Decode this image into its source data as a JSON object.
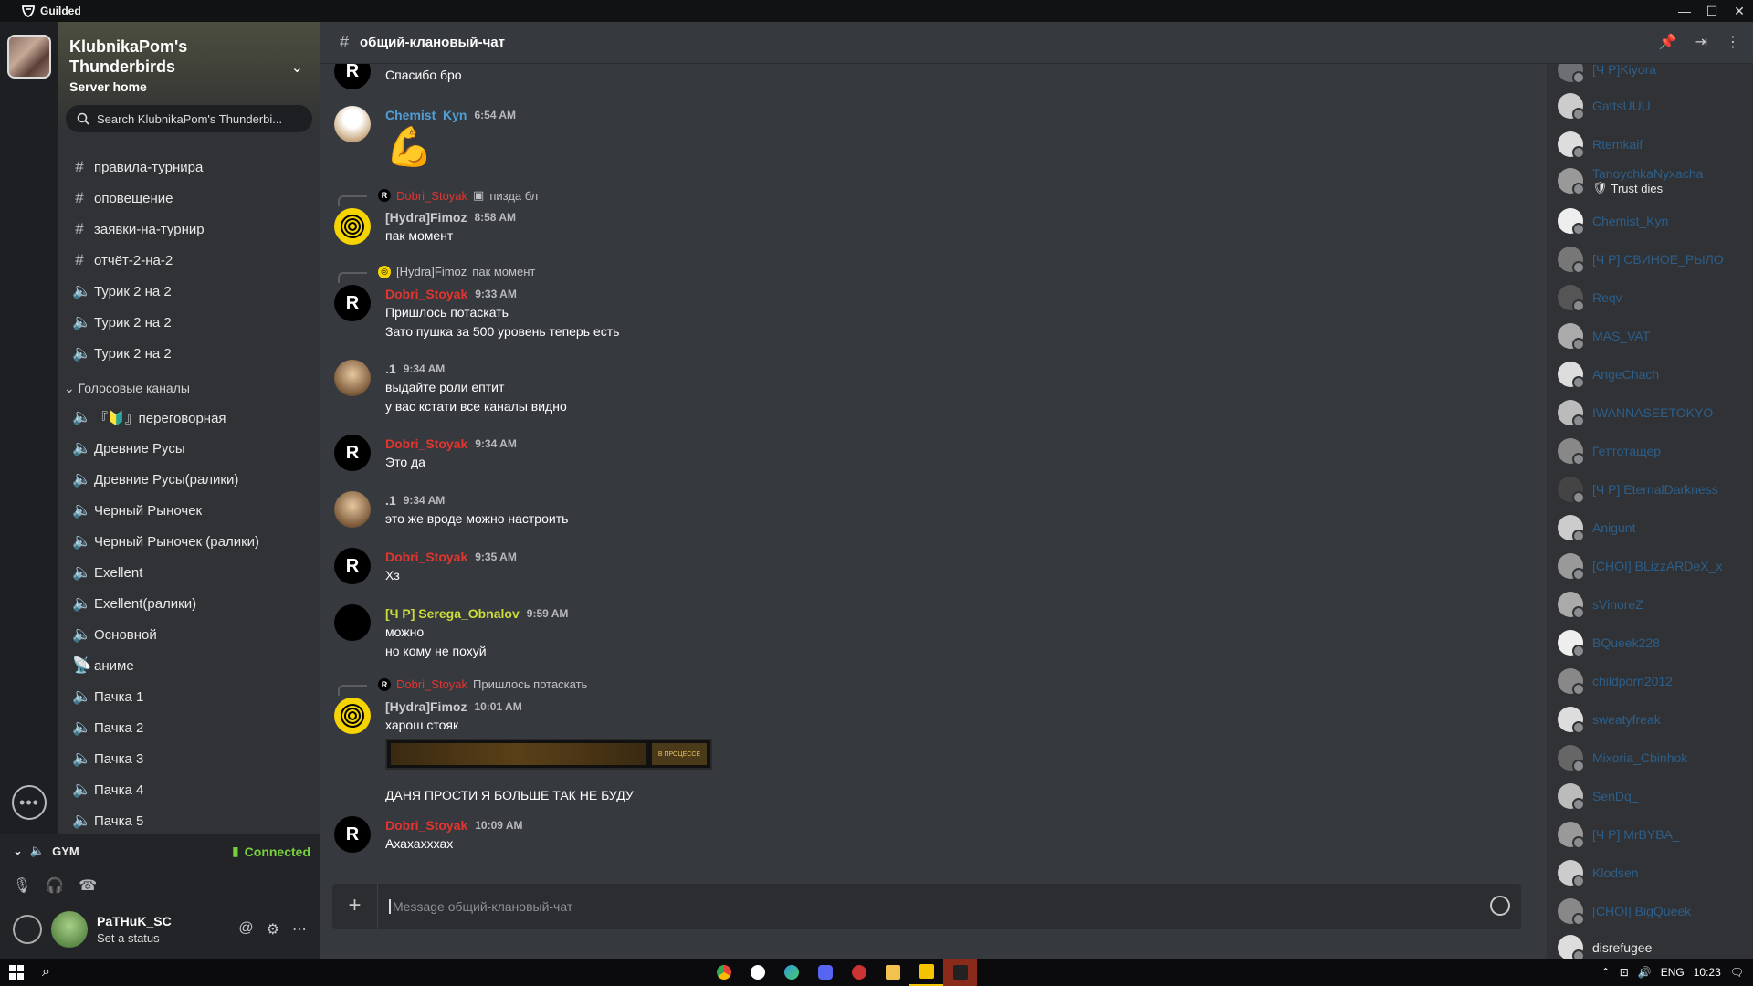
{
  "app": {
    "title": "Guilded"
  },
  "server": {
    "name": "KlubnikaPom's Thunderbirds",
    "home": "Server home",
    "search_placeholder": "Search KlubnikaPom's Thunderbi..."
  },
  "channels": {
    "text": [
      "правила-турнира",
      "оповещение",
      "заявки-на-турнир",
      "отчёт-2-на-2"
    ],
    "voice_top": [
      "Турик 2 на 2",
      "Турик 2 на 2",
      "Турик 2 на 2"
    ],
    "category": "Голосовые каналы",
    "voice": [
      "『🔰』переговорная",
      "Древние Русы",
      "Древние Русы(ралики)",
      "Черный Рыночек",
      "Черный Рыночек (ралики)",
      "Exellent",
      "Exellent(ралики)",
      "Основной",
      "аниме",
      "Пачка 1",
      "Пачка 2",
      "Пачка 3",
      "Пачка 4",
      "Пачка 5"
    ]
  },
  "voice_status": {
    "channel": "GYM",
    "status": "Connected"
  },
  "user": {
    "name": "PaTHuK_SC",
    "status": "Set a status"
  },
  "current_channel": "общий-клановый-чат",
  "messages": [
    {
      "lines": [
        "Спасибо бро"
      ]
    },
    {
      "author": "Chemist_Kyn",
      "time": "6:54 AM",
      "emoji": "💪"
    },
    {
      "reply_author": "Dobri_Stoyak",
      "reply_text": "пизда бл",
      "author": "[Hydra]Fimoz",
      "time": "8:58 AM",
      "lines": [
        "пак момент"
      ]
    },
    {
      "reply_author": "[Hydra]Fimoz",
      "reply_text": "пак момент",
      "author": "Dobri_Stoyak",
      "time": "9:33 AM",
      "lines": [
        "Пришлось потаскать",
        "Зато пушка за 500 уровень теперь есть"
      ]
    },
    {
      "author": ".1",
      "time": "9:34 AM",
      "lines": [
        "выдайте роли ептит",
        "у вас кстати все каналы видно"
      ]
    },
    {
      "author": "Dobri_Stoyak",
      "time": "9:34 AM",
      "lines": [
        "Это да"
      ]
    },
    {
      "author": ".1",
      "time": "9:34 AM",
      "lines": [
        "это же вроде можно настроить"
      ]
    },
    {
      "author": "Dobri_Stoyak",
      "time": "9:35 AM",
      "lines": [
        "Хз"
      ]
    },
    {
      "author": "[Ч Р] Serega_Obnalov",
      "time": "9:59 AM",
      "lines": [
        "можно",
        "но кому не похуй"
      ]
    },
    {
      "reply_author": "Dobri_Stoyak",
      "reply_text": "Пришлось потаскать",
      "author": "[Hydra]Fimoz",
      "time": "10:01 AM",
      "lines": [
        "харош стояк"
      ],
      "after": "ДАНЯ ПРОСТИ Я БОЛЬШЕ ТАК НЕ БУДУ",
      "image_caption": "В ПРОЦЕССЕ"
    },
    {
      "author": "Dobri_Stoyak",
      "time": "10:09 AM",
      "lines": [
        "Ахахахххах"
      ]
    }
  ],
  "composer": {
    "placeholder": "Message общий-клановый-чат"
  },
  "members": [
    {
      "name": "[Ч Р]Kiyora"
    },
    {
      "name": "GattsUUU"
    },
    {
      "name": "Rtemkaif"
    },
    {
      "name": "TanoychkaNyxacha",
      "sub": "Trust dies"
    },
    {
      "name": "Chemist_Kyn"
    },
    {
      "name": "[Ч Р] СВИНОЕ_РЫЛО"
    },
    {
      "name": "Reqv"
    },
    {
      "name": "MAS_VAT"
    },
    {
      "name": "AngeChach"
    },
    {
      "name": "IWANNASEETOKYO"
    },
    {
      "name": "Геттотащер"
    },
    {
      "name": "[Ч Р] EternalDarkness"
    },
    {
      "name": "Anigunt"
    },
    {
      "name": "[CHOI] BLizzARDeX_x"
    },
    {
      "name": "sVinoreZ"
    },
    {
      "name": "BQueek228"
    },
    {
      "name": "childporn2012"
    },
    {
      "name": "sweatyfreak"
    },
    {
      "name": "Mixoria_Cbinhok"
    },
    {
      "name": "SenDq_"
    },
    {
      "name": "[Ч Р] MrBYBA_"
    },
    {
      "name": "Klodsen"
    },
    {
      "name": "[CHOI] BigQueek"
    },
    {
      "name": "disrefugee"
    }
  ],
  "taskbar": {
    "lang": "ENG",
    "time": "10:23"
  },
  "colors": {
    "accent_red": "#e3352f",
    "link_blue": "#4f9fd6",
    "connected_green": "#78d13c",
    "role_yellow": "#cddc3a",
    "guild_gold": "#f5c400"
  }
}
